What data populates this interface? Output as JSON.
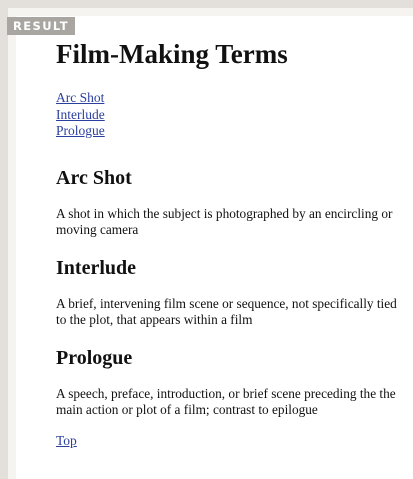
{
  "badge": "RESULT",
  "page": {
    "title": "Film-Making Terms",
    "toc": [
      "Arc Shot",
      "Interlude",
      "Prologue"
    ],
    "sections": [
      {
        "heading": "Arc Shot",
        "text": "A shot in which the subject is photographed by an encircling or moving camera"
      },
      {
        "heading": "Interlude",
        "text": "A brief, intervening film scene or sequence, not specifically tied to the plot, that appears within a film"
      },
      {
        "heading": "Prologue",
        "text": "A speech, preface, introduction, or brief scene preceding the the main action or plot of a film; contrast to epilogue"
      }
    ],
    "top_link": "Top"
  },
  "colors": {
    "link": "#2b3f9e",
    "badge_bg": "#a9a5a1",
    "outer_bg": "#e3e0dc"
  }
}
